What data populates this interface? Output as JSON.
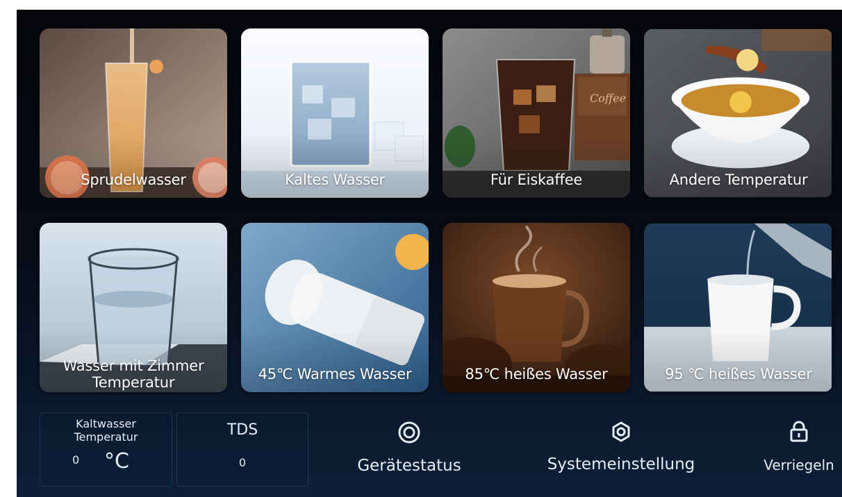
{
  "tiles": [
    {
      "label": "Sprudelwasser"
    },
    {
      "label": "Kaltes Wasser"
    },
    {
      "label": "Für Eiskaffee"
    },
    {
      "label": "Andere Temperatur"
    },
    {
      "label_line1": "Wasser mit Zimmer",
      "label_line2": "Temperatur"
    },
    {
      "label": "45℃ Warmes Wasser"
    },
    {
      "label": "85℃ heißes Wasser"
    },
    {
      "label": "95 ℃ heißes Wasser"
    }
  ],
  "status": {
    "cold_temp": {
      "title_line1": "Kaltwasser",
      "title_line2": "Temperatur",
      "value": "0",
      "unit": "°C"
    },
    "tds": {
      "title": "TDS",
      "value": "0"
    }
  },
  "actions": {
    "device_status": "Gerätestatus",
    "system_settings": "Systemeinstellung",
    "lock": "Verriegeln"
  },
  "colors": {
    "background": "#05070c",
    "text": "#e6edf5",
    "box_border": "#1c3552"
  }
}
